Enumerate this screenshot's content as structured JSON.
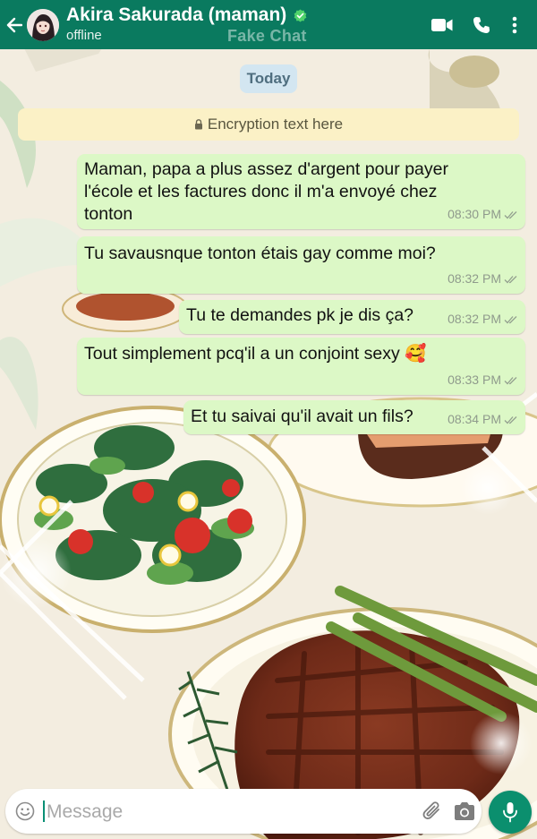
{
  "header": {
    "contact_name": "Akira Sakurada (maman)",
    "status": "offline",
    "watermark": "Fake Chat",
    "icons": [
      "back-arrow-icon",
      "video-call-icon",
      "phone-icon",
      "more-vert-icon"
    ],
    "color": "#0a7a5f"
  },
  "date_chip": "Today",
  "encryption_text": "Encryption text here",
  "messages": [
    {
      "lines": [
        "Maman,  papa a plus assez d'argent pour payer",
        "l'école et les factures donc il m'a envoyé chez",
        "tonton"
      ],
      "time": "08:30 PM"
    },
    {
      "lines": [
        "Tu savausnque tonton étais gay comme moi?"
      ],
      "time": "08:32 PM"
    },
    {
      "lines": [
        "Tu te demandes pk je dis ça?"
      ],
      "time": "08:32 PM"
    },
    {
      "lines": [
        "Tout simplement pcq'il a un conjoint sexy 🥰"
      ],
      "time": "08:33 PM"
    },
    {
      "lines": [
        "Et tu saivai qu'il avait un fils?"
      ],
      "time": "08:34 PM"
    }
  ],
  "input": {
    "placeholder": "Message",
    "icons": [
      "emoji-icon",
      "attach-icon",
      "camera-icon",
      "mic-icon"
    ]
  },
  "colors": {
    "bubble": "#dcf8c6",
    "accent": "#0b8f6e",
    "date_chip": "#d3e6f1",
    "encryption": "#fbf1c6"
  }
}
